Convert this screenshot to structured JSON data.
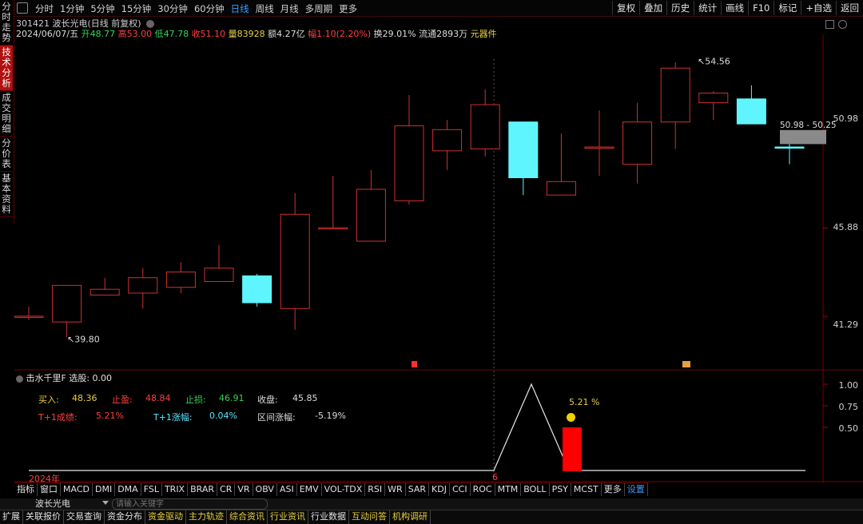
{
  "left_tabs": [
    "分时走势",
    "技术分析",
    "成交明细",
    "分价表",
    "基本资料"
  ],
  "periods": [
    "分时",
    "1分钟",
    "5分钟",
    "15分钟",
    "30分钟",
    "60分钟",
    "日线",
    "周线",
    "月线",
    "多周期",
    "更多"
  ],
  "active_period": "日线",
  "right_tools": [
    "复权",
    "叠加",
    "历史",
    "统计",
    "画线",
    "F10",
    "标记",
    "+自选",
    "返回"
  ],
  "stock": {
    "code_name": "301421 波长光电(日线 前复权)",
    "date": "2024/06/07/五",
    "open_label": "开",
    "open": "48.77",
    "high_label": "高",
    "high": "53.00",
    "low_label": "低",
    "low": "47.78",
    "close_label": "收",
    "close": "51.10",
    "volume": "量83928",
    "amount": "额4.27亿",
    "change": "幅1.10(2.20%)",
    "turnover": "换29.01%",
    "float_shares": "流通2893万",
    "sector": "元器件"
  },
  "chart_data": {
    "type": "candlestick",
    "y_axis_labels": [
      "50.98",
      "45.88",
      "41.29"
    ],
    "annotations": {
      "high": "54.56",
      "low": "39.80",
      "range": "50.98 - 50.25",
      "year": "2024年",
      "month": "6"
    },
    "candles": [
      {
        "o": 41.3,
        "c": 41.3,
        "h": 41.8,
        "l": 41.1,
        "up": true
      },
      {
        "o": 41.0,
        "c": 42.9,
        "h": 42.9,
        "l": 40.2,
        "up": true
      },
      {
        "o": 42.4,
        "c": 42.7,
        "h": 43.3,
        "l": 42.4,
        "up": true
      },
      {
        "o": 42.5,
        "c": 43.3,
        "h": 43.8,
        "l": 41.7,
        "up": true
      },
      {
        "o": 42.8,
        "c": 43.6,
        "h": 44.1,
        "l": 42.5,
        "up": true
      },
      {
        "o": 43.1,
        "c": 43.8,
        "h": 45.0,
        "l": 43.1,
        "up": true
      },
      {
        "o": 43.4,
        "c": 42.0,
        "h": 43.5,
        "l": 41.8,
        "up": false
      },
      {
        "o": 41.7,
        "c": 46.6,
        "h": 47.7,
        "l": 40.6,
        "up": true
      },
      {
        "o": 45.9,
        "c": 45.9,
        "h": 48.6,
        "l": 45.9,
        "up": true
      },
      {
        "o": 45.2,
        "c": 47.9,
        "h": 48.9,
        "l": 45.2,
        "up": true
      },
      {
        "o": 47.3,
        "c": 51.2,
        "h": 52.8,
        "l": 47.1,
        "up": true
      },
      {
        "o": 49.9,
        "c": 51.0,
        "h": 51.5,
        "l": 48.9,
        "up": true
      },
      {
        "o": 50.0,
        "c": 52.3,
        "h": 53.1,
        "l": 49.6,
        "up": true
      },
      {
        "o": 51.4,
        "c": 48.5,
        "h": 51.4,
        "l": 47.6,
        "up": false
      },
      {
        "o": 47.6,
        "c": 48.3,
        "h": 50.8,
        "l": 47.6,
        "up": true
      },
      {
        "o": 50.1,
        "c": 50.1,
        "h": 52.0,
        "l": 48.6,
        "up": true
      },
      {
        "o": 49.2,
        "c": 51.4,
        "h": 52.4,
        "l": 48.2,
        "up": true
      },
      {
        "o": 51.4,
        "c": 54.2,
        "h": 54.5,
        "l": 50.0,
        "up": true
      },
      {
        "o": 52.4,
        "c": 52.9,
        "h": 53.0,
        "l": 51.5,
        "up": true
      },
      {
        "o": 52.6,
        "c": 51.3,
        "h": 53.3,
        "l": 51.3,
        "up": false
      },
      {
        "o": 50.1,
        "c": 50.1,
        "h": 50.4,
        "l": 49.2,
        "up": false
      }
    ]
  },
  "indicator": {
    "title": "击水千里F",
    "selection": "选股: 0.00",
    "buy_label": "买入:",
    "buy": "48.36",
    "tp_label": "止盈:",
    "tp": "48.84",
    "sl_label": "止损:",
    "sl": "46.91",
    "close_label": "收盘:",
    "close": "45.85",
    "t1_result_label": "T+1成绩:",
    "t1_result": "5.21%",
    "t1_change_label": "T+1涨幅:",
    "t1_change": "0.04%",
    "range_change_label": "区间涨幅:",
    "range_change": "-5.19%",
    "bar_pct": "5.21 %",
    "axis_labels": [
      "1.00",
      "0.75",
      "0.50"
    ]
  },
  "indicator_tabs": [
    "指标",
    "窗口",
    "MACD",
    "DMI",
    "DMA",
    "FSL",
    "TRIX",
    "BRAR",
    "CR",
    "VR",
    "OBV",
    "ASI",
    "EMV",
    "VOL-TDX",
    "RSI",
    "WR",
    "SAR",
    "KDJ",
    "CCI",
    "ROC",
    "MTM",
    "BOLL",
    "PSY",
    "MCST",
    "更多",
    "设置"
  ],
  "search": {
    "stock": "波长光电",
    "placeholder": "请输入关键字"
  },
  "bottom_tabs": [
    "扩展",
    "关联报价",
    "交易查询",
    "资金分布",
    "资金驱动",
    "主力轨迹",
    "综合资讯",
    "行业资讯",
    "行业数据",
    "互动问答",
    "机构调研"
  ],
  "colors": {
    "up": "#ff3030",
    "down": "#5ff5ff",
    "bg": "#000000"
  }
}
